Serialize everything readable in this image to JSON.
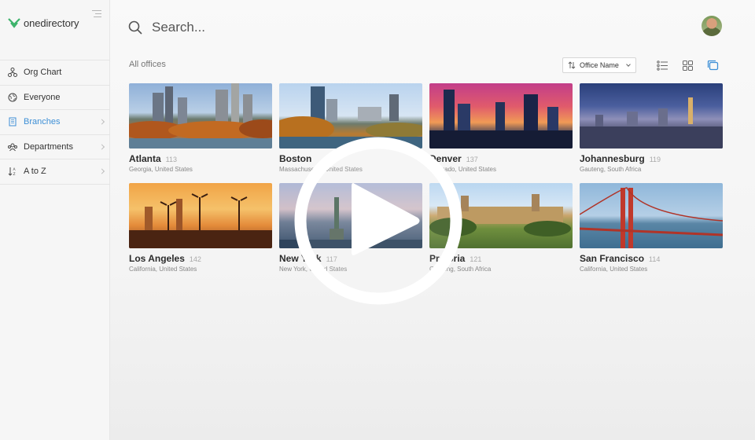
{
  "app": {
    "logo_text": "onedirectory"
  },
  "sidebar": {
    "items": [
      {
        "label": "Org Chart",
        "icon": "org-chart-icon",
        "active": false,
        "has_chevron": false
      },
      {
        "label": "Everyone",
        "icon": "globe-icon",
        "active": false,
        "has_chevron": false
      },
      {
        "label": "Branches",
        "icon": "building-icon",
        "active": true,
        "has_chevron": true
      },
      {
        "label": "Departments",
        "icon": "departments-icon",
        "active": false,
        "has_chevron": true
      },
      {
        "label": "A to Z",
        "icon": "sort-az-icon",
        "active": false,
        "has_chevron": true
      }
    ]
  },
  "search": {
    "placeholder": "Search..."
  },
  "main": {
    "section_title": "All offices",
    "sort_label": "Office Name",
    "offices": [
      {
        "name": "Atlanta",
        "count": "113",
        "location": "Georgia, United States"
      },
      {
        "name": "Boston",
        "count": "",
        "location": "Massachusetts, United States"
      },
      {
        "name": "Denver",
        "count": "137",
        "location": "Colorado, United States"
      },
      {
        "name": "Johannesburg",
        "count": "119",
        "location": "Gauteng, South Africa"
      },
      {
        "name": "Los Angeles",
        "count": "142",
        "location": "California, United States"
      },
      {
        "name": "New York",
        "count": "117",
        "location": "New York, United States"
      },
      {
        "name": "Pretoria",
        "count": "121",
        "location": "Gauteng, South Africa"
      },
      {
        "name": "San Francisco",
        "count": "114",
        "location": "California, United States"
      }
    ]
  },
  "colors": {
    "accent": "#3d8fd6",
    "logo_green": "#3db36b"
  }
}
